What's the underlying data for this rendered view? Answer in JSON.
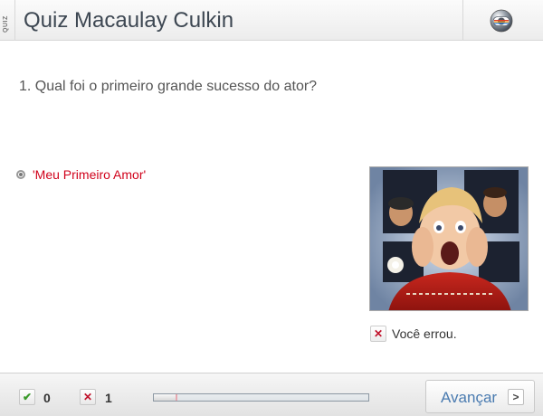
{
  "header": {
    "quiz_tag": "QUIZ",
    "title": "Quiz Macaulay Culkin",
    "logo_icon": "globo-logo-icon"
  },
  "question": {
    "text": "1. Qual foi o primeiro grande sucesso do ator?"
  },
  "options": [
    {
      "label": "'Meu Primeiro Amor'",
      "state": "selected-wrong"
    }
  ],
  "feedback": {
    "icon": "wrong-x-icon",
    "text": "Você errou."
  },
  "footer": {
    "correct_icon": "check-icon",
    "correct_count": "0",
    "wrong_icon": "x-icon",
    "wrong_count": "1",
    "progress_fraction": 0.1,
    "next_label": "Avançar",
    "next_icon": "chevron-right-icon"
  },
  "colors": {
    "accent_blue": "#4a7bb0",
    "wrong_red": "#d0021b",
    "correct_green": "#3a9a2a"
  }
}
